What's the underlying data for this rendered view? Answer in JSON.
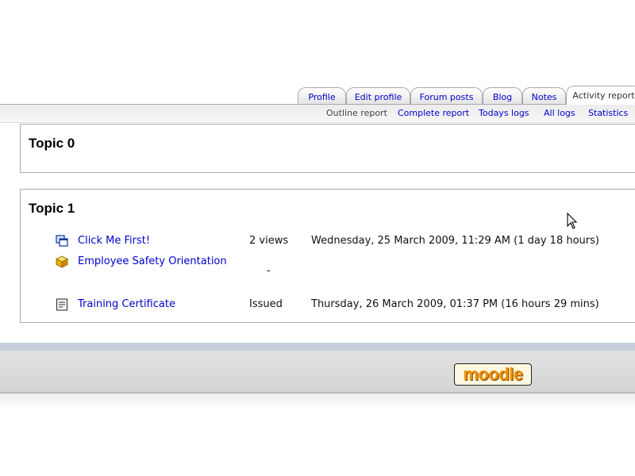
{
  "tabs": [
    {
      "label": "Profile"
    },
    {
      "label": "Edit profile"
    },
    {
      "label": "Forum posts"
    },
    {
      "label": "Blog"
    },
    {
      "label": "Notes"
    },
    {
      "label": "Activity report",
      "active": true
    }
  ],
  "subtabs": [
    {
      "label": "Outline report",
      "current": true
    },
    {
      "label": "Complete report"
    },
    {
      "label": "Todays logs"
    },
    {
      "label": "All logs"
    },
    {
      "label": "Statistics"
    }
  ],
  "topics": [
    {
      "title": "Topic 0"
    },
    {
      "title": "Topic 1",
      "activities": [
        {
          "icon": "resource-window-icon",
          "name": "Click Me First!",
          "status": "2 views",
          "last_access": "Wednesday, 25 March 2009, 11:29 AM (1 day 18 hours)"
        },
        {
          "icon": "scorm-package-icon",
          "name": "Employee Safety Orientation",
          "status": "-",
          "last_access": ""
        },
        {
          "icon": "certificate-icon",
          "name": "Training Certificate",
          "status": "Issued",
          "last_access": "Thursday, 26 March 2009, 01:37 PM (16 hours 29 mins)"
        }
      ]
    }
  ],
  "footer": {
    "logo_text": "moodle"
  },
  "colors": {
    "link": "#0000cc",
    "logo_orange": "#f39000"
  }
}
